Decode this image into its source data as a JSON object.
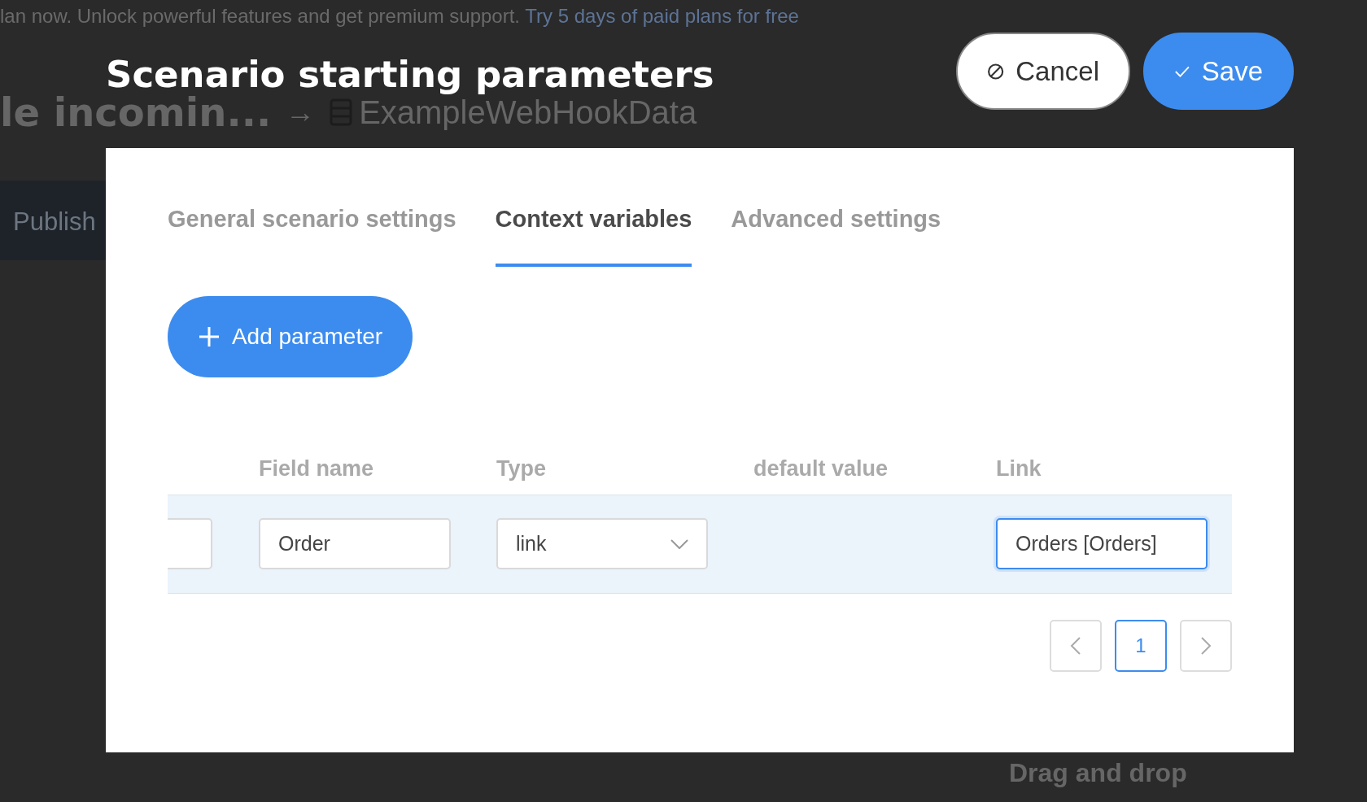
{
  "background": {
    "banner_text": "lan now. Unlock powerful features and get premium support.",
    "banner_link": "Try 5 days of paid plans for free",
    "page_title": "le incomin...",
    "page_arrow": "→",
    "breadcrumb": "ExampleWebHookData",
    "side_button": "Publish",
    "drop_hint": "Drag and drop"
  },
  "dialog": {
    "title": "Scenario starting parameters",
    "cancel": "Cancel",
    "save": "Save",
    "tabs": [
      {
        "label": "General scenario settings",
        "selected": false
      },
      {
        "label": "Context variables",
        "selected": true
      },
      {
        "label": "Advanced settings",
        "selected": false
      }
    ],
    "add_button": "Add parameter",
    "table": {
      "columns": [
        "Field name",
        "Type",
        "default value",
        "Link"
      ],
      "rows": [
        {
          "field_name": "Order",
          "type": "link",
          "link": "Orders [Orders]",
          "link_focused": true
        }
      ]
    },
    "pagination": {
      "pages": [
        {
          "label": "1",
          "selected": true
        }
      ]
    }
  }
}
